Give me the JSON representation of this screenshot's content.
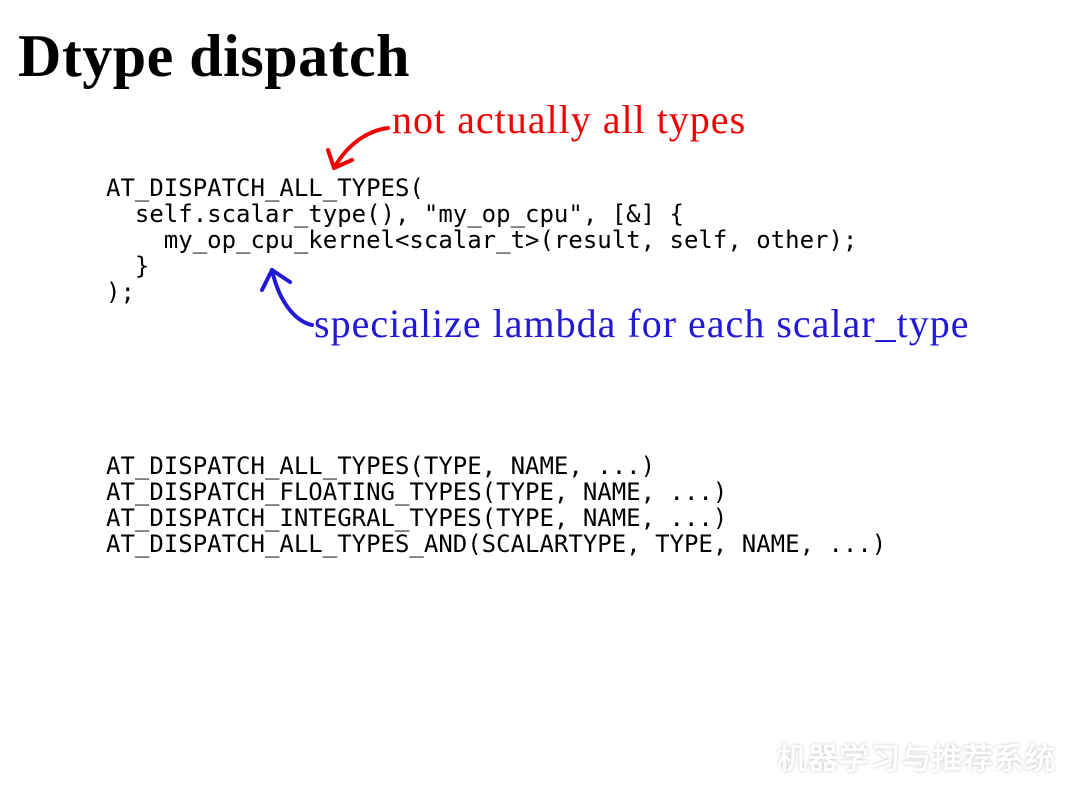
{
  "title": "Dtype dispatch",
  "annotations": {
    "red": "not  actually all  types",
    "blue": "specialize  lambda for each  scalar_type"
  },
  "code_block_1": "AT_DISPATCH_ALL_TYPES(\n  self.scalar_type(), \"my_op_cpu\", [&] {\n    my_op_cpu_kernel<scalar_t>(result, self, other);\n  }\n);",
  "code_block_2": "AT_DISPATCH_ALL_TYPES(TYPE, NAME, ...)\nAT_DISPATCH_FLOATING_TYPES(TYPE, NAME, ...)\nAT_DISPATCH_INTEGRAL_TYPES(TYPE, NAME, ...)\nAT_DISPATCH_ALL_TYPES_AND(SCALARTYPE, TYPE, NAME, ...)",
  "watermark": "机器学习与推荐系统",
  "colors": {
    "red": "#ee0202",
    "blue": "#2219d6"
  }
}
